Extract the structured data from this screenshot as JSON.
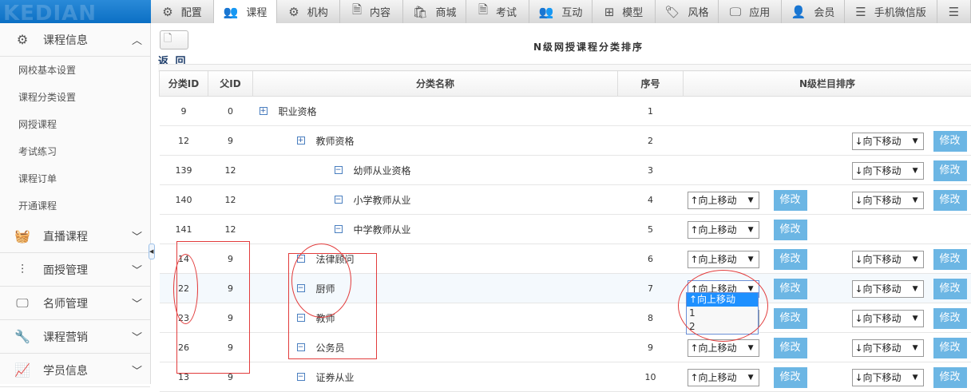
{
  "logo": "KEDIAN EDU",
  "topnav": [
    {
      "label": "配置",
      "icon": "gear-icon",
      "glyph": "⚙"
    },
    {
      "label": "课程",
      "icon": "users-icon",
      "glyph": "👥",
      "active": true
    },
    {
      "label": "机构",
      "icon": "gear-icon",
      "glyph": "⚙"
    },
    {
      "label": "内容",
      "icon": "document-icon",
      "glyph": "🗎"
    },
    {
      "label": "商城",
      "icon": "bag-icon",
      "glyph": "🛍"
    },
    {
      "label": "考试",
      "icon": "file-icon",
      "glyph": "🗎"
    },
    {
      "label": "互动",
      "icon": "users-icon",
      "glyph": "👥"
    },
    {
      "label": "模型",
      "icon": "grid-icon",
      "glyph": "⊞"
    },
    {
      "label": "风格",
      "icon": "tag-icon",
      "glyph": "🏷"
    },
    {
      "label": "应用",
      "icon": "monitor-icon",
      "glyph": "🖵"
    },
    {
      "label": "会员",
      "icon": "user-icon",
      "glyph": "👤"
    },
    {
      "label": "手机微信版",
      "icon": "list-icon",
      "glyph": "☰"
    },
    {
      "label": "",
      "icon": "menu-icon",
      "glyph": "☰"
    }
  ],
  "sidebar": {
    "open_section": {
      "label": "课程信息",
      "icon": "gear-icon",
      "glyph": "⚙",
      "items": [
        "网校基本设置",
        "课程分类设置",
        "网授课程",
        "考试练习",
        "课程订单",
        "开通课程"
      ]
    },
    "sections": [
      {
        "label": "直播课程",
        "icon": "basket-icon",
        "glyph": "🧺"
      },
      {
        "label": "面授管理",
        "icon": "sliders-icon",
        "glyph": "⫶"
      },
      {
        "label": "名师管理",
        "icon": "monitor-icon",
        "glyph": "🖵"
      },
      {
        "label": "课程营销",
        "icon": "wrench-icon",
        "glyph": "🔧"
      },
      {
        "label": "学员信息",
        "icon": "chart-icon",
        "glyph": "📈"
      }
    ]
  },
  "main": {
    "title": "N级网授课程分类排序",
    "back": "返 回",
    "headers": [
      "分类ID",
      "父ID",
      "分类名称",
      "序号",
      "N级栏目排序"
    ],
    "up_label": "↑向上移动",
    "down_label": "↓向下移动",
    "edit_label": "修改",
    "dropdown_options": [
      "↑向上移动",
      "1",
      "2"
    ],
    "rows": [
      {
        "id": "9",
        "pid": "0",
        "name": "职业资格",
        "level": 0,
        "exp": "+",
        "order": "1",
        "up": false,
        "down": false
      },
      {
        "id": "12",
        "pid": "9",
        "name": "教师资格",
        "level": 1,
        "exp": "+",
        "order": "2",
        "up": false,
        "down": true
      },
      {
        "id": "139",
        "pid": "12",
        "name": "幼师从业资格",
        "level": 2,
        "exp": "−",
        "order": "3",
        "up": false,
        "down": true
      },
      {
        "id": "140",
        "pid": "12",
        "name": "小学教师从业",
        "level": 2,
        "exp": "−",
        "order": "4",
        "up": true,
        "down": true
      },
      {
        "id": "141",
        "pid": "12",
        "name": "中学教师从业",
        "level": 2,
        "exp": "−",
        "order": "5",
        "up": true,
        "down": false
      },
      {
        "id": "14",
        "pid": "9",
        "name": "法律顾问",
        "level": 1,
        "exp": "−",
        "order": "6",
        "up": true,
        "down": true
      },
      {
        "id": "22",
        "pid": "9",
        "name": "厨师",
        "level": 1,
        "exp": "−",
        "order": "7",
        "up": true,
        "down": true
      },
      {
        "id": "23",
        "pid": "9",
        "name": "教师",
        "level": 1,
        "exp": "−",
        "order": "8",
        "up": true,
        "down": true
      },
      {
        "id": "26",
        "pid": "9",
        "name": "公务员",
        "level": 1,
        "exp": "−",
        "order": "9",
        "up": true,
        "down": true
      },
      {
        "id": "13",
        "pid": "9",
        "name": "证券从业",
        "level": 1,
        "exp": "−",
        "order": "10",
        "up": true,
        "down": true
      }
    ]
  }
}
